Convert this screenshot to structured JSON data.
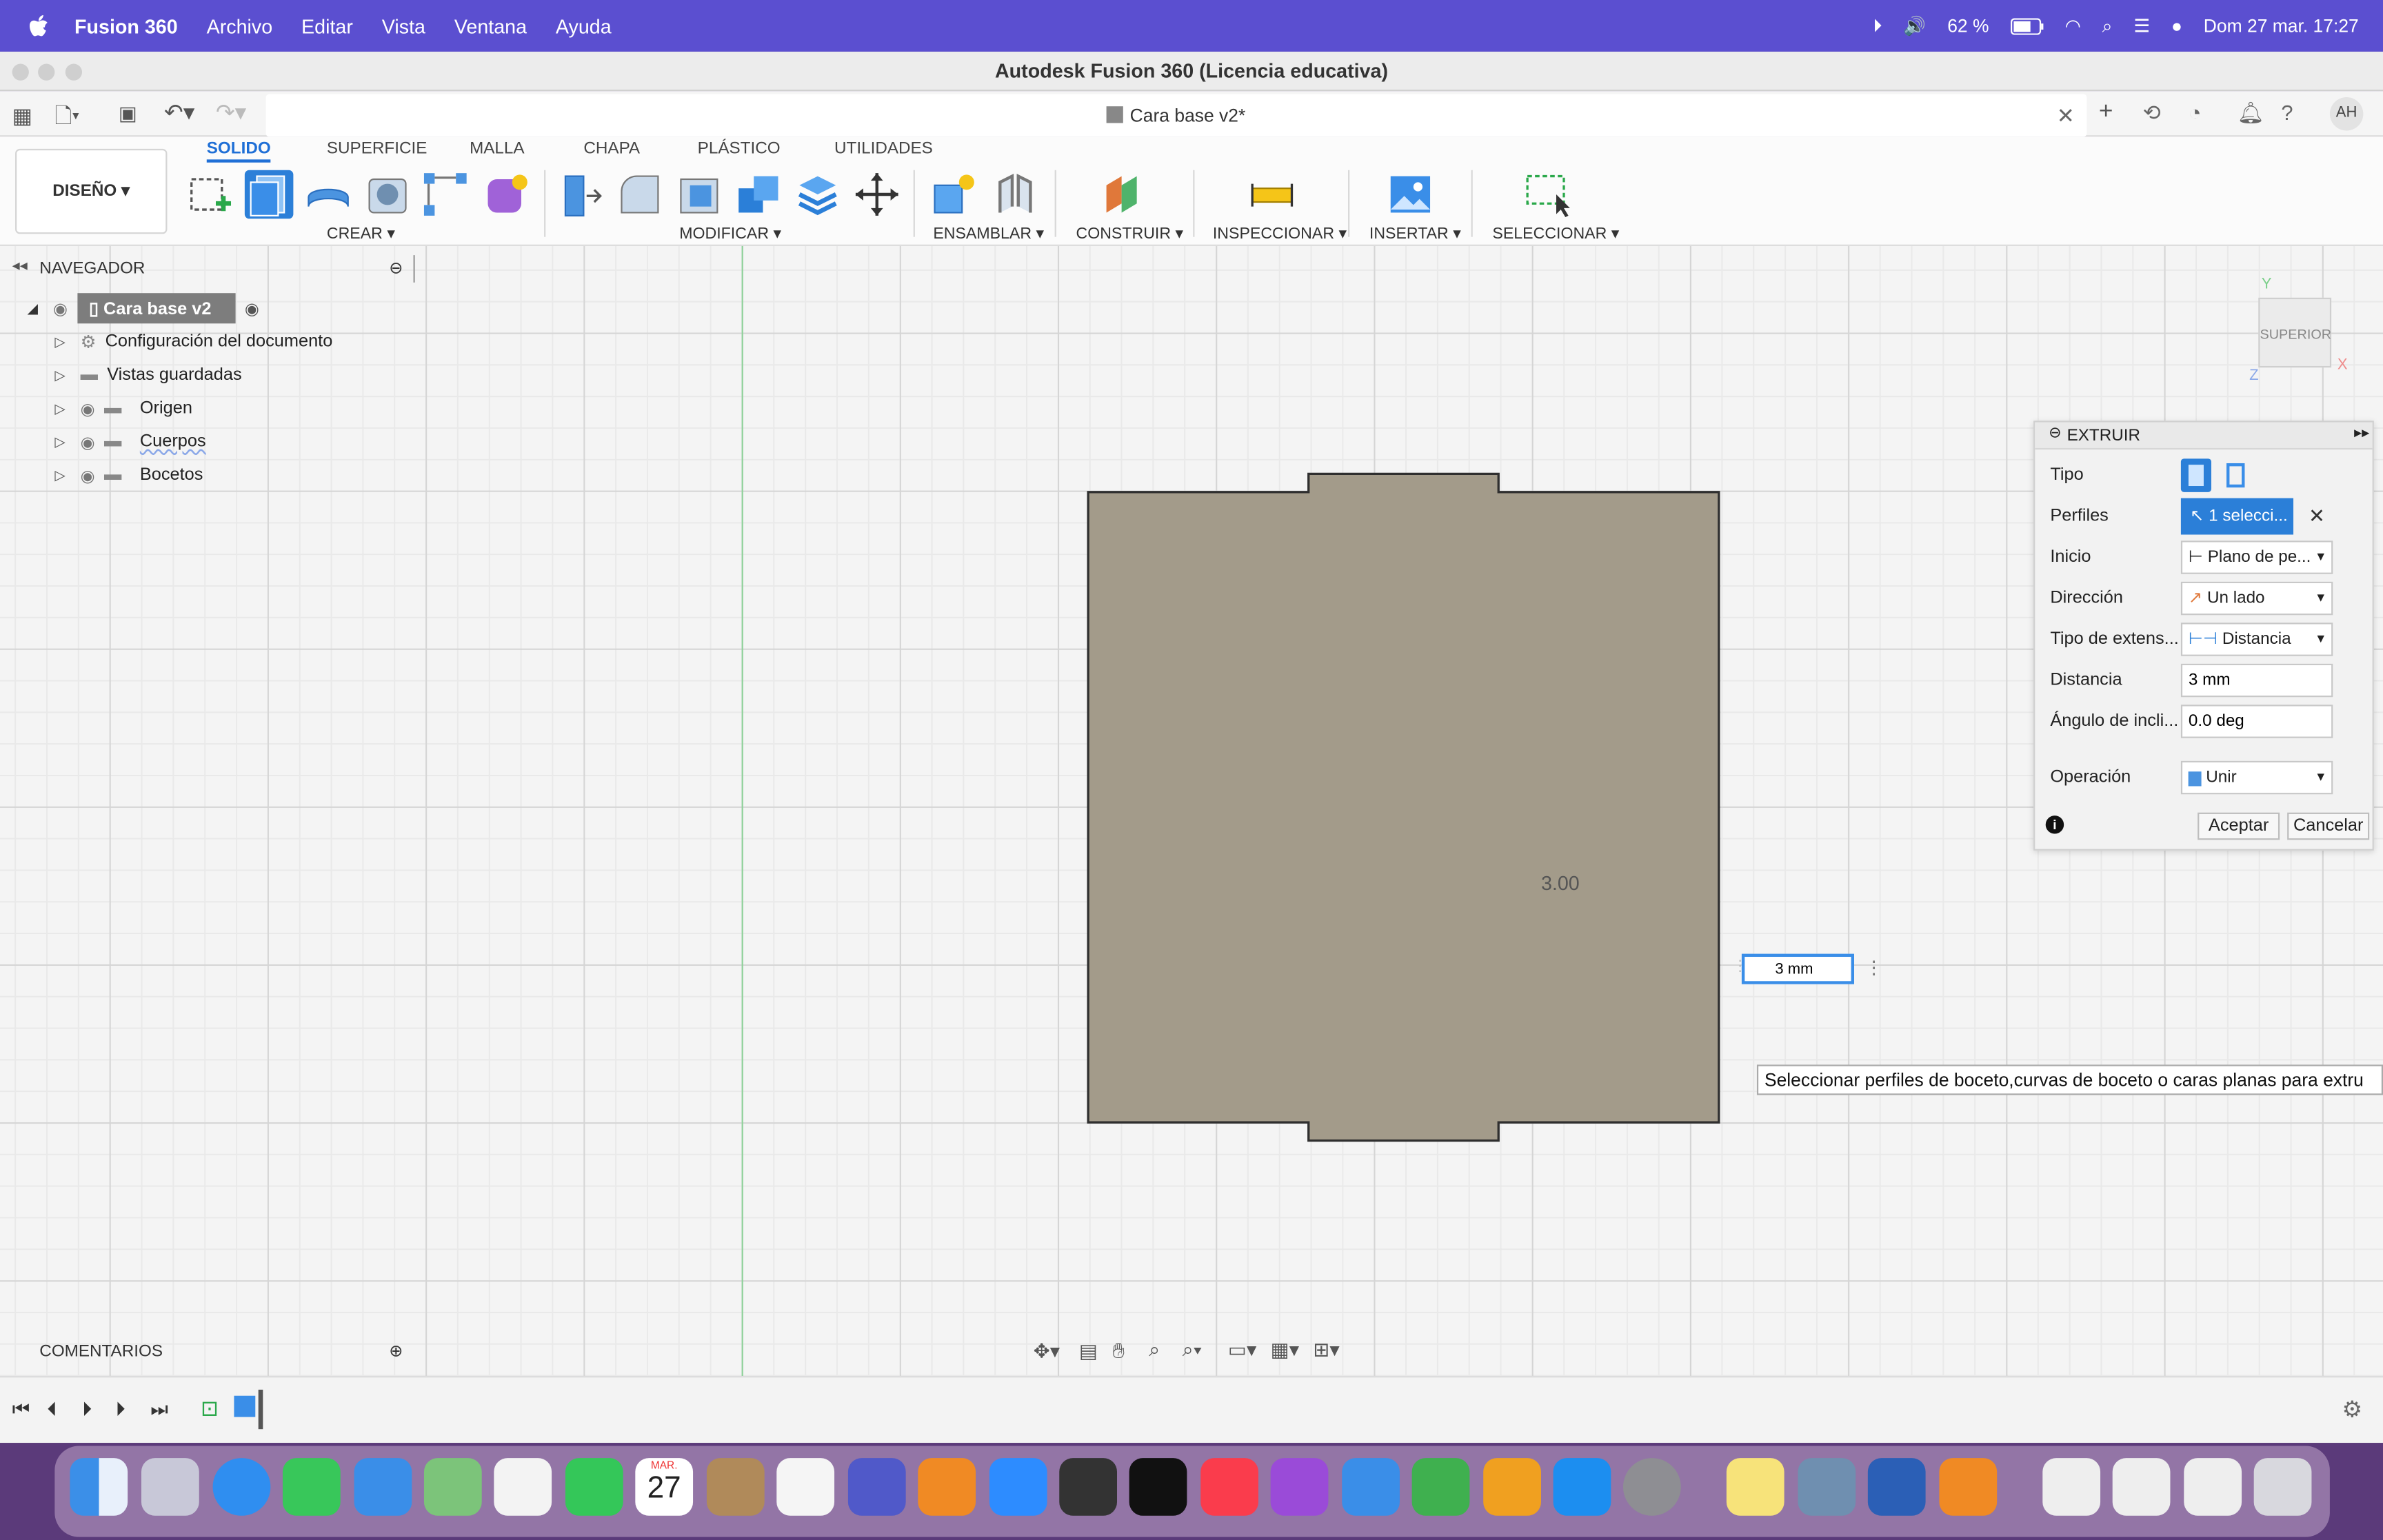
{
  "menubar": {
    "apple_icon": "apple-icon",
    "app_name": "Fusion 360",
    "items": [
      "Archivo",
      "Editar",
      "Vista",
      "Ventana",
      "Ayuda"
    ],
    "battery": "62 %",
    "datetime": "Dom 27 mar.  17:27"
  },
  "window": {
    "title": "Autodesk Fusion 360 (Licencia educativa)",
    "doc_tab": "Cara base v2*",
    "user_initials": "AH"
  },
  "ribbon": {
    "workspace": "DISEÑO ▾",
    "tabs": [
      "SOLIDO",
      "SUPERFICIE",
      "MALLA",
      "CHAPA",
      "PLÁSTICO",
      "UTILIDADES"
    ],
    "active_tab": "SOLIDO",
    "groups": {
      "crear": "CREAR ▾",
      "modificar": "MODIFICAR ▾",
      "ensamblar": "ENSAMBLAR ▾",
      "construir": "CONSTRUIR ▾",
      "inspeccionar": "INSPECCIONAR ▾",
      "insertar": "INSERTAR ▾",
      "seleccionar": "SELECCIONAR ▾"
    }
  },
  "navigator": {
    "title": "NAVEGADOR",
    "root": "Cara base v2",
    "items": [
      "Configuración del documento",
      "Vistas guardadas",
      "Origen",
      "Cuerpos",
      "Bocetos"
    ]
  },
  "comments": {
    "title": "COMENTARIOS"
  },
  "viewcube": {
    "face": "SUPERIOR",
    "x": "X",
    "y": "Y",
    "z": "Z"
  },
  "canvas": {
    "dimension_label": "3.00",
    "input_value": "3 mm",
    "tooltip": "Seleccionar perfiles de boceto,curvas de boceto o caras planas para extru"
  },
  "extrude": {
    "title": "EXTRUIR",
    "rows": {
      "tipo": "Tipo",
      "perfiles": "Perfiles",
      "perfiles_value": "1 selecci...",
      "inicio": "Inicio",
      "inicio_value": "Plano de pe...",
      "direccion": "Dirección",
      "direccion_value": "Un lado",
      "tipo_ext": "Tipo de extens...",
      "tipo_ext_value": "Distancia",
      "distancia": "Distancia",
      "distancia_value": "3 mm",
      "angulo": "Ángulo de incli...",
      "angulo_value": "0.0 deg",
      "operacion": "Operación",
      "operacion_value": "Unir"
    },
    "ok": "Aceptar",
    "cancel": "Cancelar"
  },
  "dock": {
    "calendar_month": "MAR.",
    "calendar_day": "27"
  },
  "colors": {
    "menubar": "#5b4fd0",
    "accent": "#1f6fd6",
    "body_fill": "#a39b8a"
  }
}
